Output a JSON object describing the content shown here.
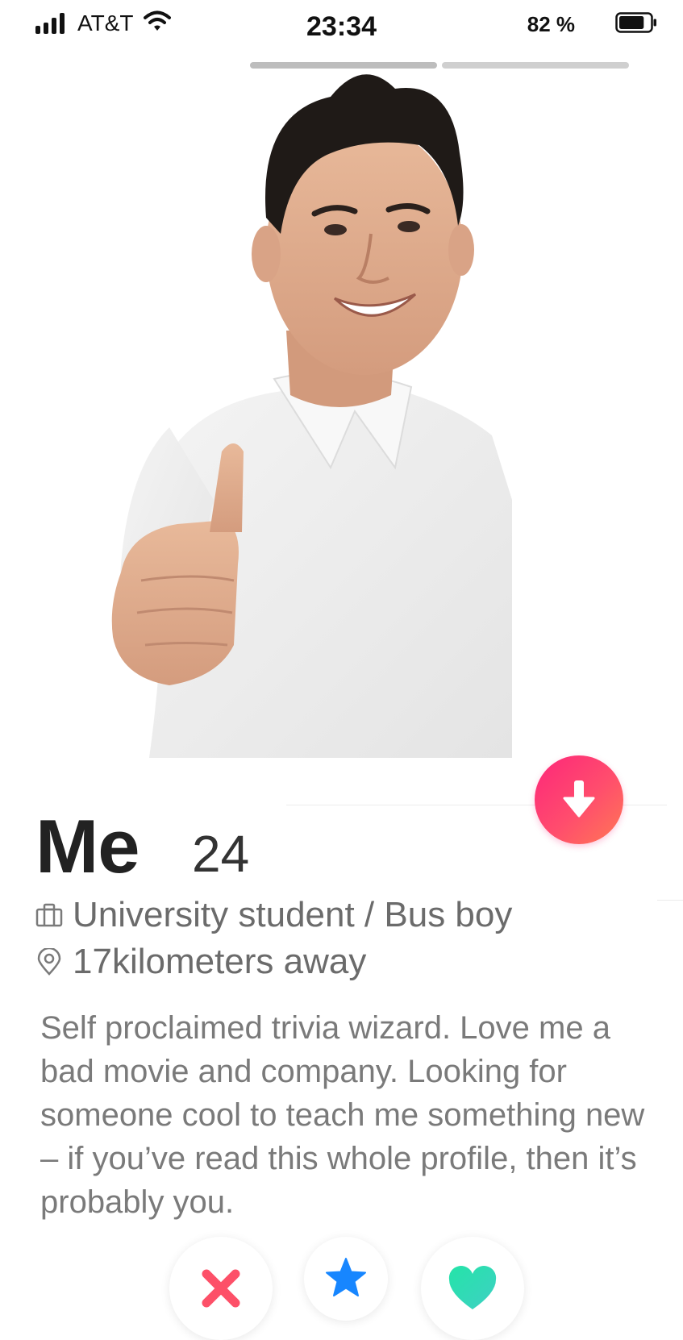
{
  "status_bar": {
    "carrier": "AT&T",
    "time": "23:34",
    "battery_percent": "82 %",
    "battery_level": 0.82
  },
  "photos": {
    "count": 2,
    "current": 1
  },
  "profile": {
    "name": "Me",
    "age": "24",
    "job": "University student / Bus boy",
    "distance": "17kilometers away",
    "bio": "Self proclaimed trivia wizard. Love me a bad movie and company. Looking for someone cool to teach me something new – if you’ve read this whole profile, then it’s probably you."
  },
  "icons": {
    "info": "arrow-down-icon",
    "job": "briefcase-icon",
    "distance": "location-pin-icon",
    "nope": "x-icon",
    "super_like": "star-icon",
    "like": "heart-icon"
  },
  "colors": {
    "brand_gradient_start": "#fd267a",
    "brand_gradient_end": "#ff7854",
    "nope": "#fd5068",
    "super_like": "#1786ff",
    "like": "#1be4a1"
  }
}
